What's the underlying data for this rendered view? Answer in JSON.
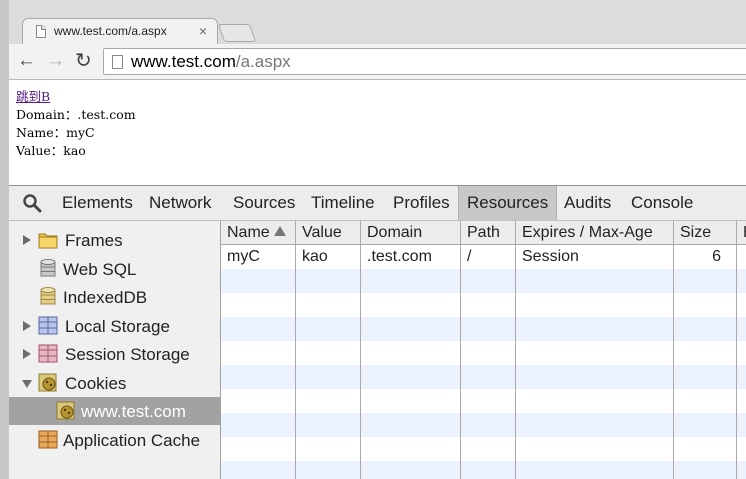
{
  "browser": {
    "tab_title": "www.test.com/a.aspx",
    "tab_close": "×",
    "url_host": "www.test.com",
    "url_path": "/a.aspx"
  },
  "page": {
    "link_text": "跳到B",
    "lines": [
      "Domain：.test.com",
      "Name：myC",
      "Value：kao"
    ]
  },
  "devtools": {
    "tabs": [
      "Elements",
      "Network",
      "Sources",
      "Timeline",
      "Profiles",
      "Resources",
      "Audits",
      "Console"
    ],
    "active_tab": "Resources",
    "sidebar": [
      {
        "label": "Frames",
        "arrow": "right",
        "icon": "folder-icon",
        "indent": 0
      },
      {
        "label": "Web SQL",
        "arrow": "none",
        "icon": "database-icon",
        "indent": 0
      },
      {
        "label": "IndexedDB",
        "arrow": "none",
        "icon": "indexeddb-icon",
        "indent": 0
      },
      {
        "label": "Local Storage",
        "arrow": "right",
        "icon": "local-storage-icon",
        "indent": 0
      },
      {
        "label": "Session Storage",
        "arrow": "right",
        "icon": "session-storage-icon",
        "indent": 0
      },
      {
        "label": "Cookies",
        "arrow": "down",
        "icon": "cookie-icon",
        "indent": 0
      },
      {
        "label": "www.test.com",
        "arrow": "none",
        "icon": "cookie-icon",
        "indent": 1,
        "selected": true
      },
      {
        "label": "Application Cache",
        "arrow": "none",
        "icon": "app-cache-icon",
        "indent": 0
      }
    ],
    "table": {
      "columns": [
        "Name",
        "Value",
        "Domain",
        "Path",
        "Expires / Max-Age",
        "Size",
        "H"
      ],
      "sorted_column": "Name",
      "rows": [
        [
          "myC",
          "kao",
          ".test.com",
          "/",
          "Session",
          "6",
          ""
        ]
      ]
    }
  },
  "colors": {
    "row_alt": "#ebf2fd",
    "selected_item": "#a2a2a2",
    "link": "#551a8b"
  }
}
